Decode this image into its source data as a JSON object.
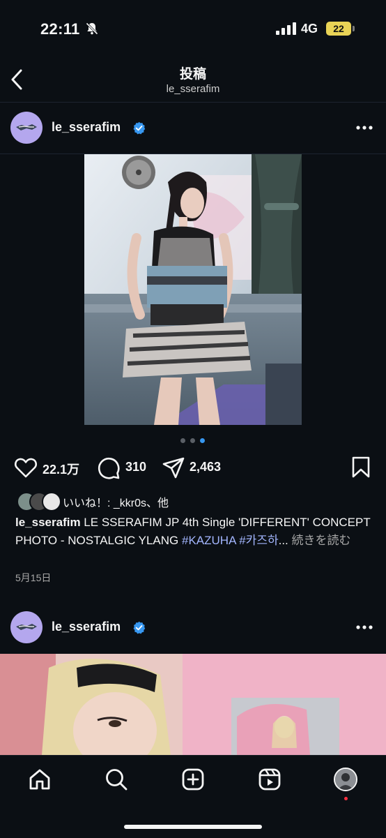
{
  "status_bar": {
    "time": "22:11",
    "network": "4G",
    "battery": "22"
  },
  "header": {
    "title": "投稿",
    "subtitle": "le_sserafim"
  },
  "post1": {
    "username": "le_sserafim",
    "likes": "22.1万",
    "comments": "310",
    "shares": "2,463",
    "liked_by": "いいね！: _kkr0s、他",
    "caption_user": "le_sserafim",
    "caption_text": " LE SSERAFIM JP 4th Single 'DIFFERENT' CONCEPT PHOTO - NOSTALGIC YLANG ",
    "hashtag1": "#KAZUHA",
    "hashtag2": "#카즈하",
    "ellipsis": "...",
    "more_label": " 続きを読む",
    "date": "5月15日",
    "carousel_total": 3,
    "carousel_active": 3
  },
  "post2": {
    "username": "le_sserafim"
  },
  "icons": [
    "bell-off-icon",
    "signal-icon",
    "back-icon",
    "verified-icon",
    "more-icon",
    "heart-icon",
    "comment-icon",
    "share-icon",
    "bookmark-icon",
    "home-icon",
    "search-icon",
    "create-icon",
    "reels-icon",
    "profile-icon"
  ],
  "colors": {
    "background": "#0b0f14",
    "accent": "#3797f0",
    "hashtag": "#a3b6ff",
    "avatar": "#b4a7ee"
  }
}
